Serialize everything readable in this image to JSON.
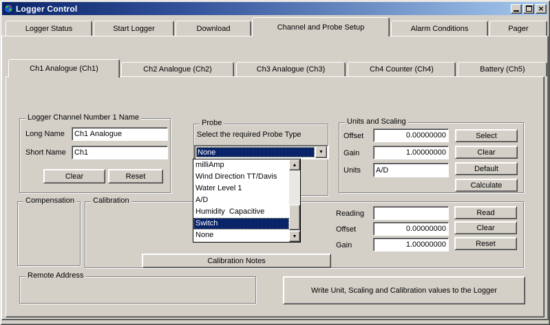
{
  "window": {
    "title": "Logger Control"
  },
  "icons": {
    "close": "×",
    "combo_dropdown": "▼",
    "scroll_up": "▲",
    "scroll_down": "▼"
  },
  "colors": {
    "titlebar_gradient_start": "#0a246a",
    "titlebar_gradient_end": "#a6caf0",
    "selection_bg": "#0a246a",
    "window_face": "#d4d0c8"
  },
  "tabs_main": [
    {
      "label": "Logger Status",
      "active": false
    },
    {
      "label": "Start Logger",
      "active": false
    },
    {
      "label": "Download",
      "active": false
    },
    {
      "label": "Channel and Probe Setup",
      "active": true
    },
    {
      "label": "Alarm Conditions",
      "active": false
    },
    {
      "label": "Pager",
      "active": false
    }
  ],
  "tabs_channel": [
    {
      "label": "Ch1 Analogue (Ch1)",
      "active": true
    },
    {
      "label": "Ch2 Analogue (Ch2)",
      "active": false
    },
    {
      "label": "Ch3 Analogue (Ch3)",
      "active": false
    },
    {
      "label": "Ch4 Counter (Ch4)",
      "active": false
    },
    {
      "label": "Battery (Ch5)",
      "active": false
    }
  ],
  "name_group": {
    "caption": "Logger Channel Number 1 Name",
    "long_name_label": "Long Name",
    "long_name_value": "Ch1 Analogue",
    "short_name_label": "Short Name",
    "short_name_value": "Ch1",
    "clear_button": "Clear",
    "reset_button": "Reset"
  },
  "probe_group": {
    "caption": "Probe",
    "label": "Select the required Probe Type",
    "selected_value": "None",
    "list_items": [
      "milliAmp",
      "Wind Direction TT/Davis",
      "Water Level 1",
      "A/D",
      "Humidity  Capacitive",
      "Switch",
      "None"
    ],
    "highlighted_item": "Switch"
  },
  "units_group": {
    "caption": "Units and Scaling",
    "offset_label": "Offset",
    "offset_value": "0.00000000",
    "gain_label": "Gain",
    "gain_value": "1.00000000",
    "units_label": "Units",
    "units_value": "A/D",
    "select_button": "Select",
    "clear_button": "Clear",
    "default_button": "Default",
    "calculate_button": "Calculate"
  },
  "compensation_group": {
    "caption": "Compensation"
  },
  "calibration_group": {
    "caption": "Calibration",
    "reading_label": "Reading",
    "reading_value": "",
    "offset_label": "Offset",
    "offset_value": "0.00000000",
    "gain_label": "Gain",
    "gain_value": "1.00000000",
    "read_button": "Read",
    "clear_button": "Clear",
    "reset_button": "Reset",
    "notes_button": "Calibration Notes"
  },
  "remote_group": {
    "caption": "Remote Address"
  },
  "write_button": "Write Unit, Scaling and Calibration values to the Logger"
}
